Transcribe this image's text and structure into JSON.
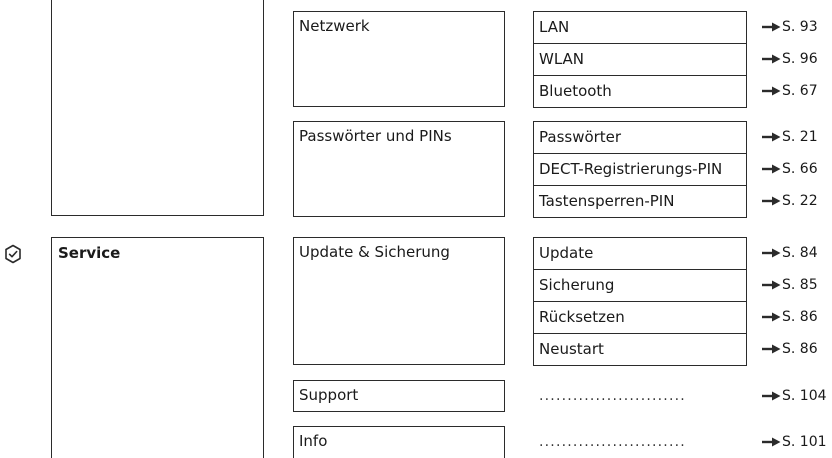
{
  "colors": {
    "border": "#2b2b2b",
    "text": "#1a1a1a",
    "icon": "#2b2b2b"
  },
  "icons": {
    "service": "shield-check-icon",
    "arrow": "arrow-right-icon"
  },
  "col2": [
    {
      "label": "Netzwerk"
    },
    {
      "label": "Passwörter und PINs"
    },
    {
      "label": "Update & Sicherung"
    },
    {
      "label": "Support"
    },
    {
      "label": "Info"
    }
  ],
  "col1": {
    "service_label": "Service"
  },
  "col3": {
    "netzwerk": [
      {
        "label": "LAN",
        "ref": "S. 93"
      },
      {
        "label": "WLAN",
        "ref": "S. 96"
      },
      {
        "label": "Bluetooth",
        "ref": "S. 67"
      }
    ],
    "passwoerter": [
      {
        "label": "Passwörter",
        "ref": "S. 21"
      },
      {
        "label": "DECT-Registrierungs-PIN",
        "ref": "S. 66"
      },
      {
        "label": "Tastensperren-PIN",
        "ref": "S. 22"
      }
    ],
    "update": [
      {
        "label": "Update",
        "ref": "S. 84"
      },
      {
        "label": "Sicherung",
        "ref": "S. 85"
      },
      {
        "label": "Rücksetzen",
        "ref": "S. 86"
      },
      {
        "label": "Neustart",
        "ref": "S. 86"
      }
    ],
    "support": {
      "dots": "..........................",
      "ref": "S. 104"
    },
    "info": {
      "dots": "..........................",
      "ref": "S. 101"
    }
  }
}
